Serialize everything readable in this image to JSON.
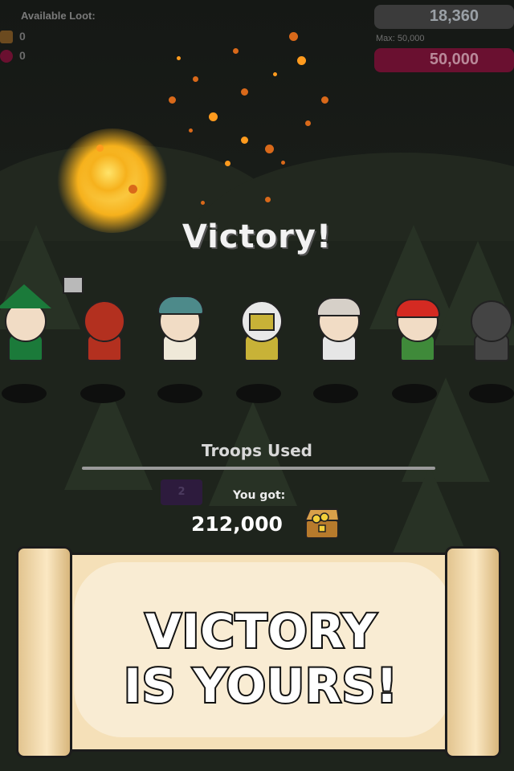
{
  "hud": {
    "available_loot_label": "Available Loot:",
    "loot": [
      {
        "icon": "gold-chest-icon",
        "value": "0"
      },
      {
        "icon": "elixir-bottle-icon",
        "value": "0"
      }
    ],
    "gold_bar_value": "18,360",
    "max_label": "Max: 50,000",
    "elixir_bar_value": "50,000",
    "colors": {
      "gold_bar": "#3b3b3b",
      "elixir_bar": "#6a1030"
    }
  },
  "result": {
    "title": "Victory!",
    "troops_used_label": "Troops Used",
    "troop_count": "2",
    "you_got_label": "You got:",
    "you_got_value": "212,000",
    "reward_icon": "treasure-chest-icon"
  },
  "troops": [
    {
      "name": "wizard",
      "color": "#1b7a3a"
    },
    {
      "name": "dwarf",
      "color": "#b3301f"
    },
    {
      "name": "archer",
      "color": "#4d8a8a"
    },
    {
      "name": "knight",
      "color": "#c8b237"
    },
    {
      "name": "priestess",
      "color": "#e6e6e6"
    },
    {
      "name": "pirate",
      "color": "#d42a22"
    },
    {
      "name": "ninja",
      "color": "#444444"
    }
  ],
  "banner": {
    "line1": "VICTORY",
    "line2": "IS YOURS!"
  }
}
